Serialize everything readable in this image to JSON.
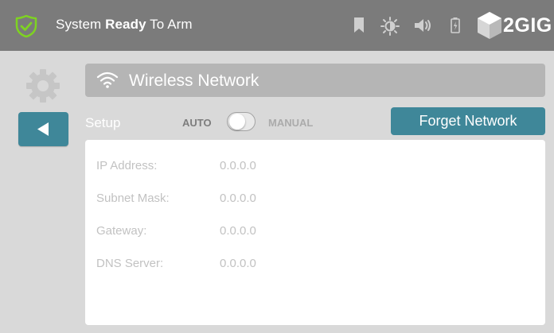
{
  "status": {
    "prefix": "System ",
    "bold": "Ready",
    "suffix": " To Arm"
  },
  "toolbar": {
    "icons": [
      "bookmark-icon",
      "brightness-icon",
      "volume-icon",
      "battery-icon"
    ]
  },
  "brand": {
    "name": "2GIG"
  },
  "header": {
    "title": "Wireless Network"
  },
  "setup": {
    "label": "Setup",
    "mode_left": "AUTO",
    "mode_right": "MANUAL",
    "manual_enabled": false
  },
  "actions": {
    "forget_label": "Forget Network"
  },
  "network_info": [
    {
      "label": "IP Address:",
      "value": "0.0.0.0"
    },
    {
      "label": "Subnet Mask:",
      "value": "0.0.0.0"
    },
    {
      "label": "Gateway:",
      "value": "0.0.0.0"
    },
    {
      "label": "DNS Server:",
      "value": "0.0.0.0"
    }
  ],
  "colors": {
    "topbar": "#7b7b7b",
    "accent": "#3f8799",
    "status_ok": "#7ed321",
    "background": "#d9d9d9"
  }
}
